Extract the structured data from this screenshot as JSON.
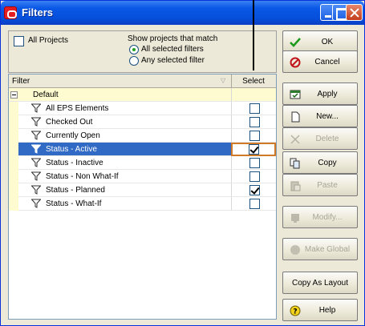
{
  "window": {
    "title": "Filters"
  },
  "options": {
    "all_projects_label": "All Projects",
    "all_projects_checked": false,
    "show_label": "Show projects that match",
    "radio_all_label": "All selected filters",
    "radio_any_label": "Any selected filter",
    "selected_match": "all"
  },
  "table": {
    "headers": {
      "filter": "Filter",
      "select": "Select"
    },
    "group": {
      "name": "Default",
      "expander": "minus"
    },
    "rows": [
      {
        "name": "All EPS Elements",
        "checked": false,
        "selected": false
      },
      {
        "name": "Checked Out",
        "checked": false,
        "selected": false
      },
      {
        "name": "Currently Open",
        "checked": false,
        "selected": false
      },
      {
        "name": "Status - Active",
        "checked": true,
        "selected": true
      },
      {
        "name": "Status - Inactive",
        "checked": false,
        "selected": false
      },
      {
        "name": "Status - Non What-If",
        "checked": false,
        "selected": false
      },
      {
        "name": "Status - Planned",
        "checked": true,
        "selected": false
      },
      {
        "name": "Status - What-If",
        "checked": false,
        "selected": false
      }
    ]
  },
  "buttons": {
    "ok": {
      "label": "OK",
      "icon": "checkmark-icon",
      "enabled": true
    },
    "cancel": {
      "label": "Cancel",
      "icon": "no-entry-icon",
      "enabled": true
    },
    "apply": {
      "label": "Apply",
      "icon": "apply-icon",
      "enabled": true
    },
    "new": {
      "label": "New...",
      "icon": "new-document-icon",
      "enabled": true
    },
    "delete": {
      "label": "Delete",
      "icon": "x-icon",
      "enabled": false
    },
    "copy": {
      "label": "Copy",
      "icon": "copy-icon",
      "enabled": true
    },
    "paste": {
      "label": "Paste",
      "icon": "paste-icon",
      "enabled": false
    },
    "modify": {
      "label": "Modify...",
      "icon": "modify-icon",
      "enabled": false
    },
    "make_global": {
      "label": "Make Global",
      "icon": "globe-icon",
      "enabled": false
    },
    "copy_as_layout": {
      "label": "Copy As Layout",
      "enabled": true
    },
    "help": {
      "label": "Help",
      "icon": "help-icon",
      "enabled": true
    }
  },
  "colors": {
    "titlebar": "#0a58e6",
    "selection": "#316ac5",
    "group_background": "#fffbd0",
    "select_highlight": "#d07a28"
  }
}
